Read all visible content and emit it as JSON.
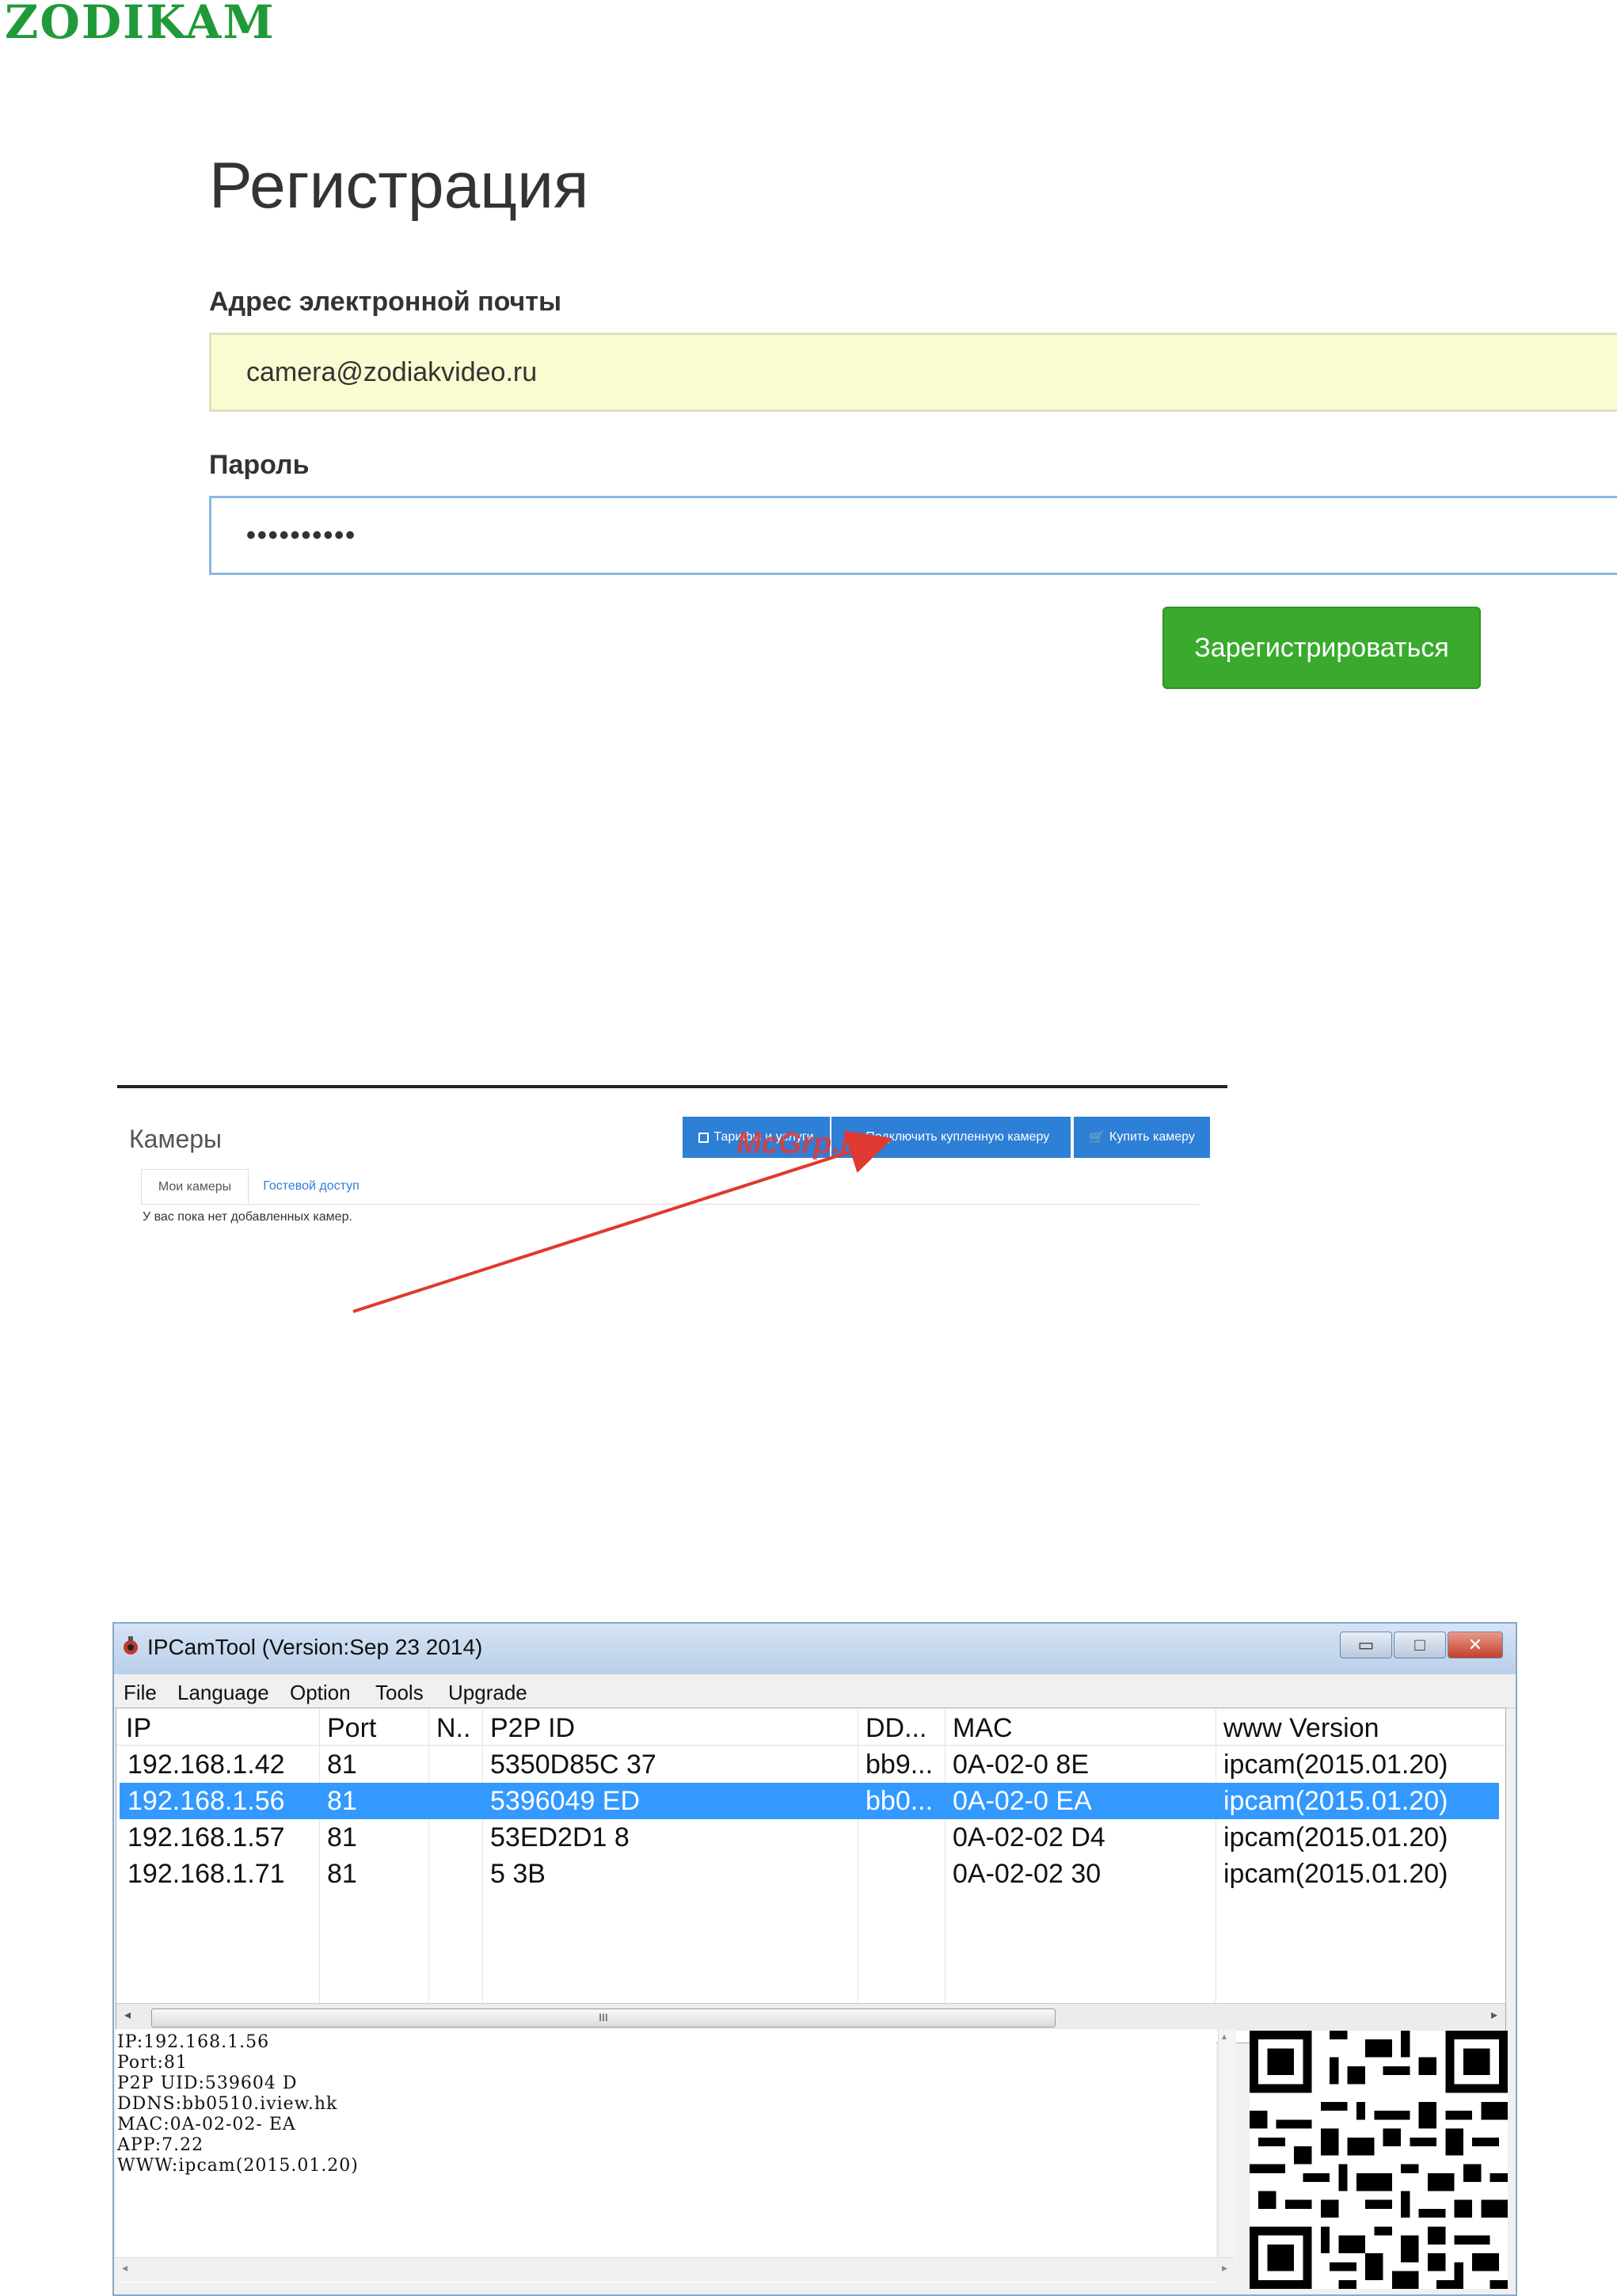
{
  "logo": {
    "text": "ZODIKAM"
  },
  "registration": {
    "title": "Регистрация",
    "email_label": "Адрес электронной почты",
    "email_value": "camera@zodiakvideo.ru",
    "password_label": "Пароль",
    "password_value": "••••••••••",
    "submit_label": "Зарегистрироваться"
  },
  "cameras": {
    "title": "Камеры",
    "buttons": [
      "Тарифы и услуги",
      "Подключить купленную камеру",
      "Купить камеру"
    ],
    "tabs": [
      "Мои камеры",
      "Гостевой доступ"
    ],
    "empty_text": "У вас пока нет добавленных камер.",
    "watermark": "McGrp.Ru",
    "arrow_color": "#e0392e"
  },
  "ipcamtool": {
    "title": "IPCamTool (Version:Sep 23 2014)",
    "menu": [
      "File",
      "Language",
      "Option",
      "Tools",
      "Upgrade"
    ],
    "columns": [
      "IP",
      "Port",
      "N..",
      "P2P ID",
      "DD...",
      "MAC",
      "www Version"
    ],
    "rows": [
      {
        "ip": "192.168.1.42",
        "port": "81",
        "n": "",
        "p2p": "5350D85C     37",
        "dd": "bb9...",
        "mac": "0A-02-0       8E",
        "ver": "ipcam(2015.01.20)",
        "selected": false
      },
      {
        "ip": "192.168.1.56",
        "port": "81",
        "n": "",
        "p2p": "5396049     ED",
        "dd": "bb0...",
        "mac": "0A-02-0         EA",
        "ver": "ipcam(2015.01.20)",
        "selected": true
      },
      {
        "ip": "192.168.1.57",
        "port": "81",
        "n": "",
        "p2p": "53ED2D1     8",
        "dd": "",
        "mac": "0A-02-02        D4",
        "ver": "ipcam(2015.01.20)",
        "selected": false
      },
      {
        "ip": "192.168.1.71",
        "port": "81",
        "n": "",
        "p2p": "5          3B",
        "dd": "",
        "mac": "0A-02-02        30",
        "ver": "ipcam(2015.01.20)",
        "selected": false
      }
    ],
    "scroll_grip": "III",
    "info_lines": [
      "IP:192.168.1.56",
      "Port:81",
      "P2P UID:539604        D",
      "DDNS:bb0510.iview.hk",
      "MAC:0A-02-02-        EA",
      "APP:7.22",
      "WWW:ipcam(2015.01.20)"
    ],
    "selection_color": "#3399ff"
  }
}
